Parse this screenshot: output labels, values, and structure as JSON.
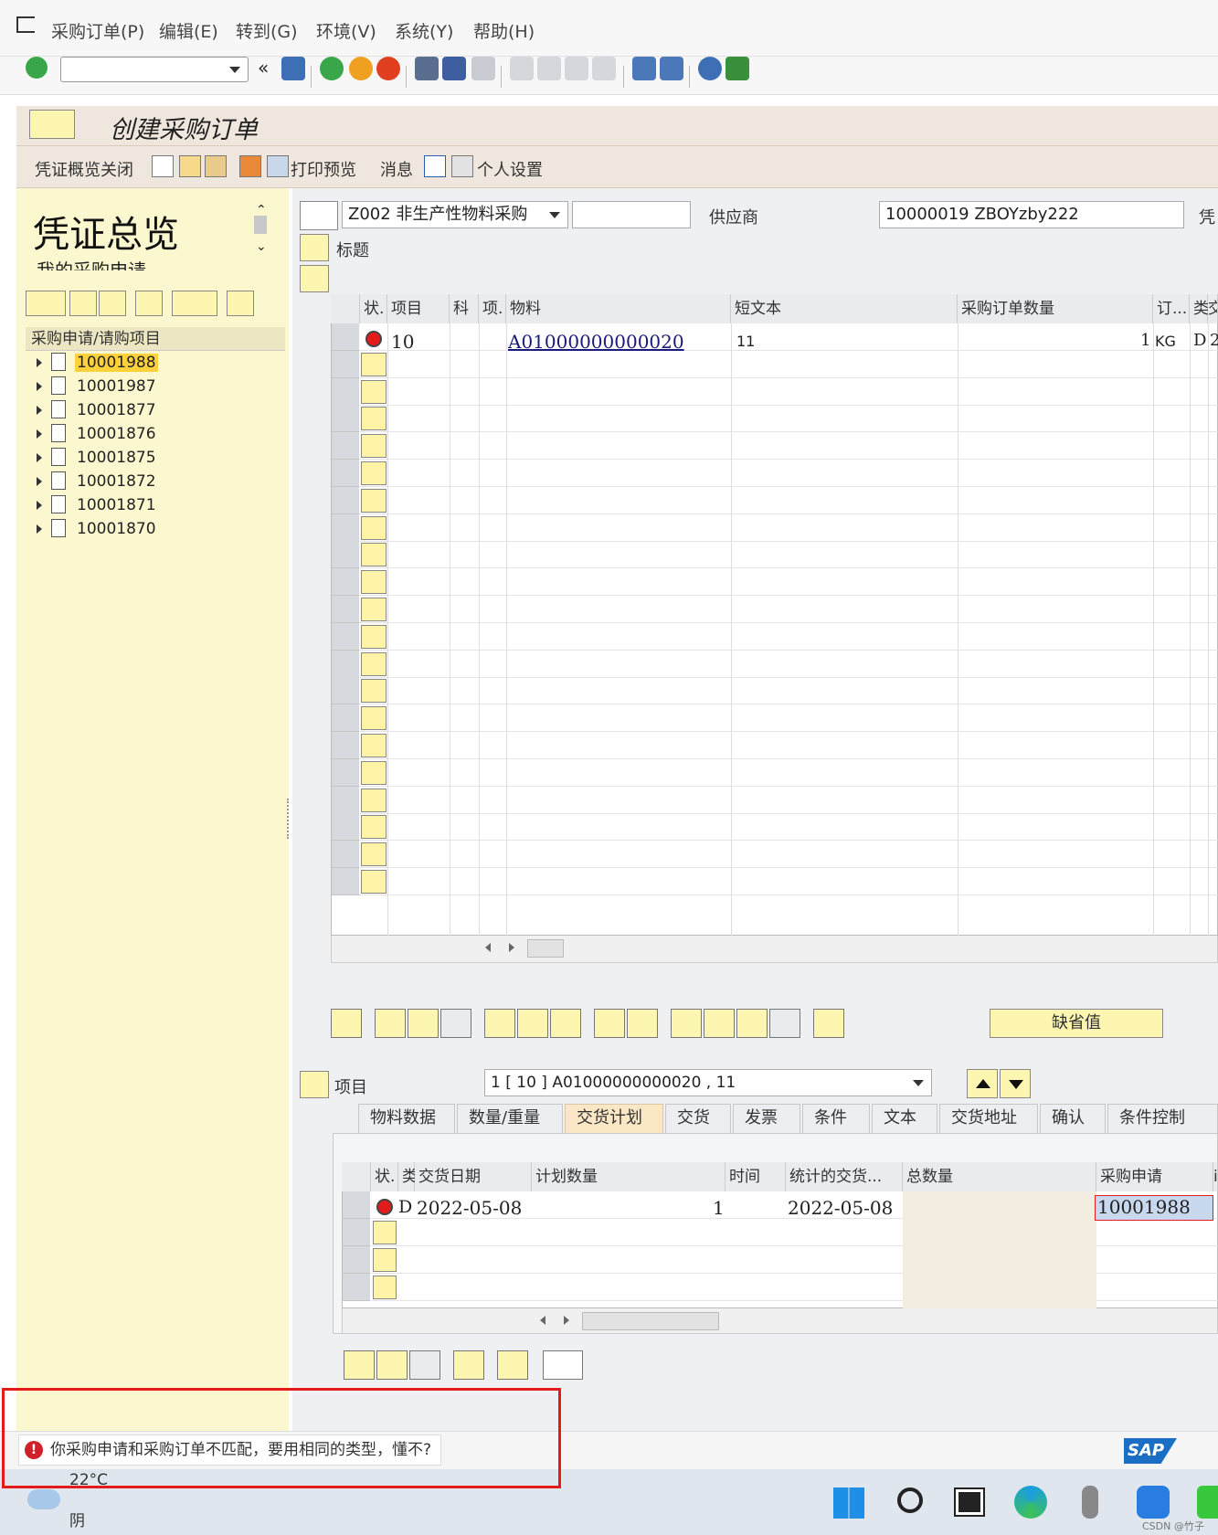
{
  "menubar": {
    "items": [
      "采购订单(P)",
      "编辑(E)",
      "转到(G)",
      "环境(V)",
      "系统(Y)",
      "帮助(H)"
    ]
  },
  "toolbar": {
    "command_value": ""
  },
  "app": {
    "title": "创建采购订单",
    "toolbar": {
      "close_overview": "凭证概览关闭",
      "print_preview": "打印预览",
      "messages": "消息",
      "personal_settings": "个人设置"
    }
  },
  "left_panel": {
    "title": "凭证总览",
    "subtitle": "我的采购申请",
    "tree_header": "采购申请/请购项目",
    "items": [
      "10001988",
      "10001987",
      "10001877",
      "10001876",
      "10001875",
      "10001872",
      "10001871",
      "10001870"
    ],
    "selected": "10001988"
  },
  "header": {
    "doc_type": "Z002 非生产性物料采购",
    "doc_number": "",
    "vendor_label": "供应商",
    "vendor_value": "10000019 ZBOYzby222",
    "doc_date_label": "凭",
    "header_label": "标题"
  },
  "items_grid": {
    "columns": [
      "状.",
      "项目",
      "科",
      "项.",
      "物料",
      "短文本",
      "采购订单数量",
      "订...",
      "类",
      "交"
    ],
    "rows": [
      {
        "item": "10",
        "material": "A01000000000020",
        "short_text": "11",
        "quantity": "1",
        "unit": "KG",
        "cat": "D",
        "extra": "2"
      }
    ]
  },
  "default_button": "缺省值",
  "item_detail": {
    "label": "项目",
    "selected": "1 [ 10 ] A01000000000020 , 11",
    "tabs": [
      "物料数据",
      "数量/重量",
      "交货计划",
      "交货",
      "发票",
      "条件",
      "文本",
      "交货地址",
      "确认",
      "条件控制"
    ],
    "active_tab": "交货计划"
  },
  "schedule_grid": {
    "columns": [
      "状.",
      "类",
      "交货日期",
      "计划数量",
      "时间",
      "统计的交货...",
      "总数量",
      "采购申请",
      "i"
    ],
    "rows": [
      {
        "cat": "D",
        "delivery_date": "2022-05-08",
        "planned_qty": "1",
        "time": "",
        "stat_date": "2022-05-08",
        "total_qty": "",
        "purchase_req": "10001988"
      }
    ]
  },
  "status": {
    "message": "你采购申请和采购订单不匹配，要用相同的类型，懂不?"
  },
  "taskbar": {
    "temperature": "22°C",
    "weather": "阴",
    "watermark": "CSDN @竹子"
  },
  "colors": {
    "error_red": "#e41b1b",
    "panel_yellow": "#fbf8cf",
    "title_beige": "#efe7de"
  }
}
